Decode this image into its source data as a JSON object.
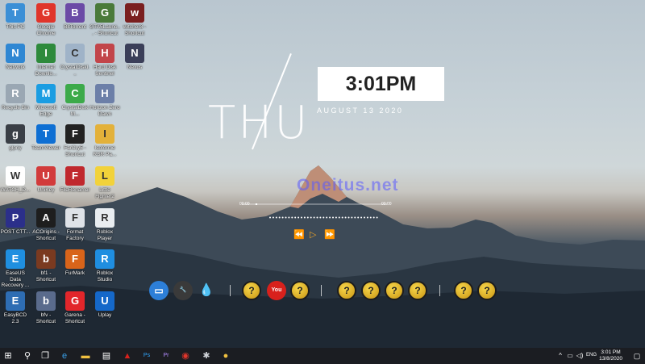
{
  "desktop": {
    "icons": [
      {
        "label": "This PC",
        "icon": "computer-icon",
        "color": "#3b8fd6"
      },
      {
        "label": "Network",
        "icon": "network-icon",
        "color": "#2f87d3"
      },
      {
        "label": "Recycle Bin",
        "icon": "recycle-bin-icon",
        "color": "#9aa7b3"
      },
      {
        "label": "glpriy",
        "icon": "laptop-icon",
        "color": "#3a3f46"
      },
      {
        "label": "WATCH_D...",
        "icon": "watch-dogs-icon",
        "color": "#ffffff"
      },
      {
        "label": "POST CTT...",
        "icon": "app-grid-icon",
        "color": "#2b2f8a"
      },
      {
        "label": "EaseUS Data Recovery ...",
        "icon": "easeus-icon",
        "color": "#1f8fe0"
      },
      {
        "label": "EasyBCD 2.3",
        "icon": "easybcd-icon",
        "color": "#2e6db3"
      },
      {
        "label": "Google Chrome",
        "icon": "chrome-icon",
        "color": "#e0352b"
      },
      {
        "label": "Internet Downlo...",
        "icon": "idm-icon",
        "color": "#2e8a3c"
      },
      {
        "label": "Microsoft Edge",
        "icon": "edge-icon",
        "color": "#1b9de2"
      },
      {
        "label": "TeamViewer",
        "icon": "teamviewer-icon",
        "color": "#0e6fd3"
      },
      {
        "label": "UniKey",
        "icon": "unikey-icon",
        "color": "#d23b3b"
      },
      {
        "label": "ACOrigins - Shortcut",
        "icon": "assassins-creed-icon",
        "color": "#1e1e1e"
      },
      {
        "label": "bf1 - Shortcut",
        "icon": "bf1-icon",
        "color": "#7a3a20"
      },
      {
        "label": "bfv - Shortcut",
        "icon": "bfv-icon",
        "color": "#5a6b8c"
      },
      {
        "label": "BitTorrent",
        "icon": "bittorrent-icon",
        "color": "#6b4aa6"
      },
      {
        "label": "CrystalDiskI...",
        "icon": "crystaldisk-icon",
        "color": "#9fb3c8"
      },
      {
        "label": "CrystalDiskM...",
        "icon": "crystaldiskmark-icon",
        "color": "#3caa4a"
      },
      {
        "label": "FarCry5 - Shortcut",
        "icon": "farcry5-icon",
        "color": "#222222"
      },
      {
        "label": "FileRenamer",
        "icon": "filerenamer-icon",
        "color": "#c0282d"
      },
      {
        "label": "Format Factory",
        "icon": "format-factory-icon",
        "color": "#dfe3e8"
      },
      {
        "label": "FurMark",
        "icon": "furmark-icon",
        "color": "#d8641a"
      },
      {
        "label": "Garena - Shortcut",
        "icon": "garena-icon",
        "color": "#e2262b"
      },
      {
        "label": "GTA5Launc... - Shortcut",
        "icon": "gta5-icon",
        "color": "#4a7a3a"
      },
      {
        "label": "Hard Disk Sentinel",
        "icon": "hdsentinel-icon",
        "color": "#c2454a"
      },
      {
        "label": "Horizon Zero Dawn",
        "icon": "horizon-icon",
        "color": "#6c7fa8"
      },
      {
        "label": "Isoforme RSR Pa...",
        "icon": "isoforme-icon",
        "color": "#e3b13a"
      },
      {
        "label": "Little Fighter2",
        "icon": "little-fighter-icon",
        "color": "#f2d23a"
      },
      {
        "label": "Roblox Player",
        "icon": "roblox-icon",
        "color": "#e9edf1"
      },
      {
        "label": "Roblox Studio",
        "icon": "roblox-studio-icon",
        "color": "#1f8ee0"
      },
      {
        "label": "Uplay",
        "icon": "uplay-icon",
        "color": "#1568c9"
      },
      {
        "label": "witcher3 - Shortcut",
        "icon": "witcher-icon",
        "color": "#7a1f1f"
      },
      {
        "label": "Nexus",
        "icon": "nexus-icon",
        "color": "#3b3f59"
      }
    ]
  },
  "clock": {
    "day": "THU",
    "time": "3:01PM",
    "date": "AUGUST 13 2020"
  },
  "watermark": "Oneitus.net",
  "player": {
    "elapsed": "00:00",
    "total": "00:00",
    "accent": "#e6a02a"
  },
  "dock": [
    {
      "name": "dock-monitor-icon",
      "color": "#2d7fd8",
      "glyph": "▭"
    },
    {
      "name": "dock-wrench-icon",
      "color": "#3a3a3a",
      "glyph": "🔧"
    },
    {
      "name": "dock-drop-icon",
      "color": "none",
      "glyph": "💧"
    },
    {
      "name": "dock-help-icon-1",
      "color": "qmark",
      "glyph": "?"
    },
    {
      "name": "dock-youtube-icon",
      "color": "#d8211c",
      "glyph": "You"
    },
    {
      "name": "dock-help-icon-2",
      "color": "qmark",
      "glyph": "?"
    },
    {
      "name": "dock-help-icon-3",
      "color": "qmark",
      "glyph": "?"
    },
    {
      "name": "dock-help-icon-4",
      "color": "qmark",
      "glyph": "?"
    },
    {
      "name": "dock-help-icon-5",
      "color": "qmark",
      "glyph": "?"
    },
    {
      "name": "dock-help-icon-6",
      "color": "qmark",
      "glyph": "?"
    },
    {
      "name": "dock-help-icon-7",
      "color": "qmark",
      "glyph": "?"
    },
    {
      "name": "dock-help-icon-8",
      "color": "qmark",
      "glyph": "?"
    }
  ],
  "taskbar": {
    "apps": [
      {
        "name": "start-button",
        "glyph": "⊞"
      },
      {
        "name": "search-icon",
        "glyph": "⚲"
      },
      {
        "name": "task-view-icon",
        "glyph": "❐"
      },
      {
        "name": "edge-taskbar-icon",
        "glyph": "e"
      },
      {
        "name": "file-explorer-icon",
        "glyph": "▬"
      },
      {
        "name": "store-icon",
        "glyph": "▤"
      },
      {
        "name": "msi-afterburner-icon",
        "glyph": "▲"
      },
      {
        "name": "photoshop-icon",
        "glyph": "Ps"
      },
      {
        "name": "premiere-icon",
        "glyph": "Pr"
      },
      {
        "name": "chrome-taskbar-icon",
        "glyph": "◉"
      },
      {
        "name": "tool-taskbar-icon",
        "glyph": "✱"
      },
      {
        "name": "drop-taskbar-icon",
        "glyph": "●"
      }
    ],
    "language": "ENG",
    "time": "3:01 PM",
    "date": "13/8/2020"
  }
}
